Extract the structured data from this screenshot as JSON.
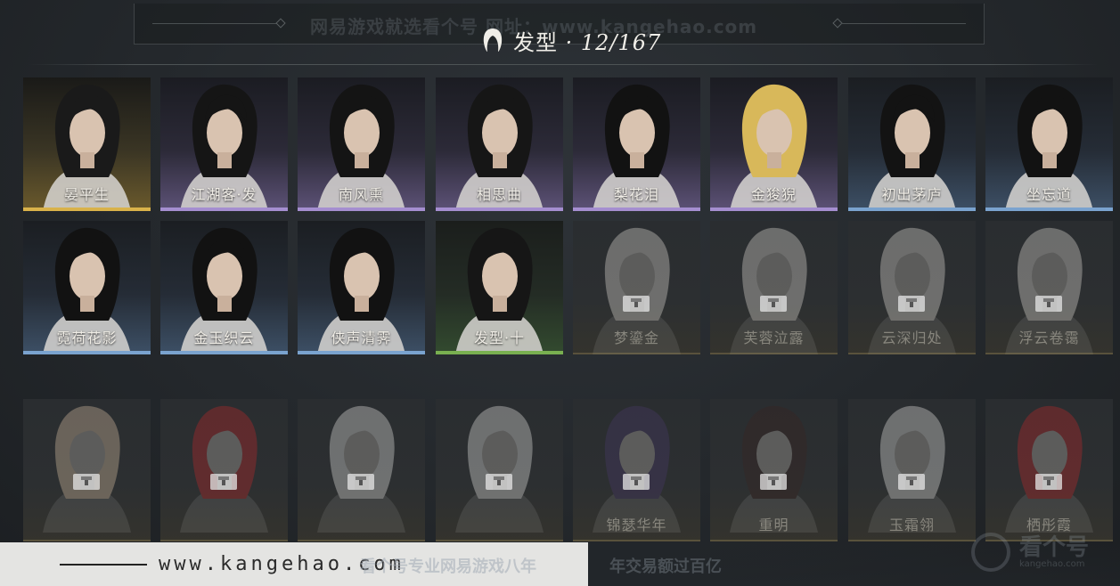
{
  "header": {
    "title_label": "发型",
    "title_sep": " · ",
    "count": "12/167",
    "watermark": "网易游戏就选看个号  网址：www.kangehao.com"
  },
  "cards": [
    {
      "name": "晏平生",
      "tier": "gold",
      "locked": false,
      "hair": "#1a1a1a"
    },
    {
      "name": "江湖客·发",
      "tier": "purple",
      "locked": false,
      "hair": "#151515"
    },
    {
      "name": "南风熏",
      "tier": "purple",
      "locked": false,
      "hair": "#141414"
    },
    {
      "name": "相思曲",
      "tier": "purple",
      "locked": false,
      "hair": "#161616"
    },
    {
      "name": "梨花泪",
      "tier": "purple",
      "locked": false,
      "hair": "#121212"
    },
    {
      "name": "金狻猊",
      "tier": "purple",
      "locked": false,
      "hair": "#d8b85a"
    },
    {
      "name": "初出茅庐",
      "tier": "blue",
      "locked": false,
      "hair": "#131313"
    },
    {
      "name": "坐忘道",
      "tier": "blue",
      "locked": false,
      "hair": "#121212"
    },
    {
      "name": "霓荷花影",
      "tier": "blue",
      "locked": false,
      "hair": "#121212"
    },
    {
      "name": "金玉织云",
      "tier": "blue",
      "locked": false,
      "hair": "#121212"
    },
    {
      "name": "侠声清霁",
      "tier": "blue",
      "locked": false,
      "hair": "#121212"
    },
    {
      "name": "发型·十",
      "tier": "green",
      "locked": false,
      "hair": "#161616"
    },
    {
      "name": "梦鎏金",
      "tier": "locked",
      "locked": true,
      "hair": "#e8e4dc"
    },
    {
      "name": "芙蓉泣露",
      "tier": "locked",
      "locked": true,
      "hair": "#e8e4dc"
    },
    {
      "name": "云深归处",
      "tier": "locked",
      "locked": true,
      "hair": "#e8e4dc"
    },
    {
      "name": "浮云卷霭",
      "tier": "locked",
      "locked": true,
      "hair": "#e8e4dc"
    },
    {
      "name": "",
      "tier": "locked",
      "locked": true,
      "hair": "#e0c6a8"
    },
    {
      "name": "",
      "tier": "locked",
      "locked": true,
      "hair": "#c0282a"
    },
    {
      "name": "",
      "tier": "locked",
      "locked": true,
      "hair": "#ecebe8"
    },
    {
      "name": "",
      "tier": "locked",
      "locked": true,
      "hair": "#ecebe8"
    },
    {
      "name": "锦瑟华年",
      "tier": "locked",
      "locked": true,
      "hair": "#4a3a6a"
    },
    {
      "name": "重明",
      "tier": "locked",
      "locked": true,
      "hair": "#3a2420"
    },
    {
      "name": "玉霜翎",
      "tier": "locked",
      "locked": true,
      "hair": "#ecebe8"
    },
    {
      "name": "栖彤霞",
      "tier": "locked",
      "locked": true,
      "hair": "#c0282a"
    }
  ],
  "banner": {
    "url": "www.kangehao.com",
    "slogan": "看个号专业网易游戏八年  年交易额过百亿"
  },
  "corner_logo": {
    "text": "看个号",
    "sub": "kangehao.com"
  }
}
